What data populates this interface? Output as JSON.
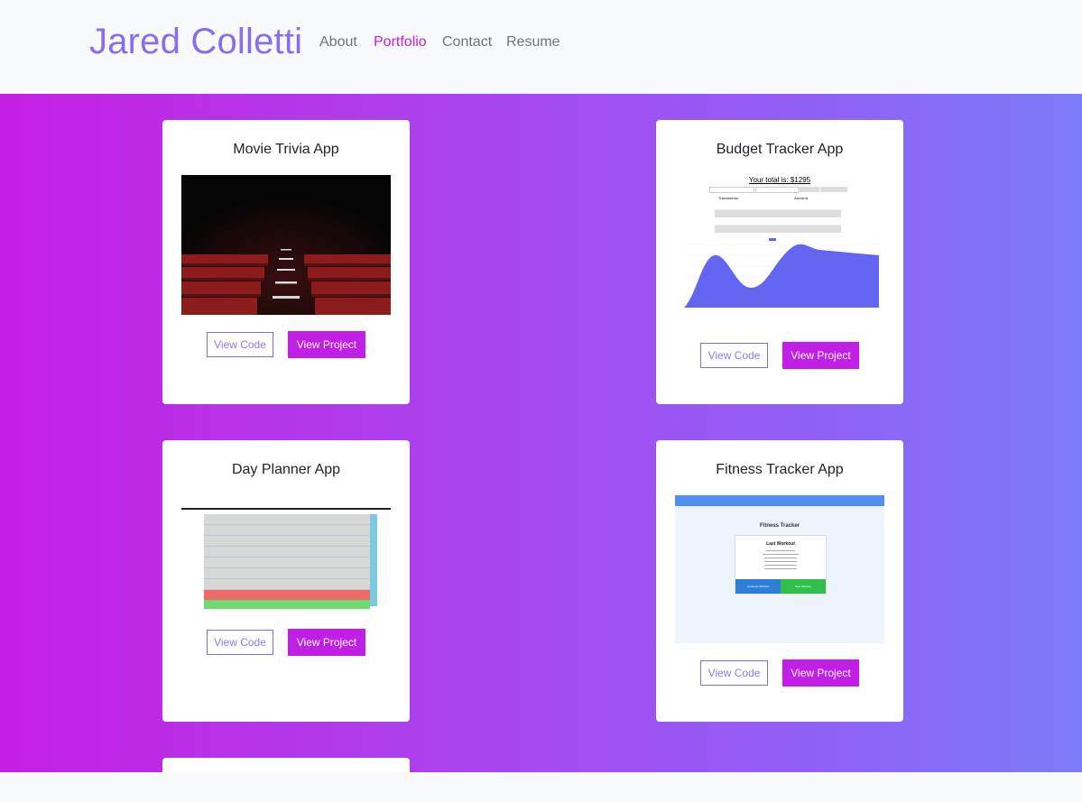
{
  "navbar": {
    "brand": "Jared Colletti",
    "links": [
      {
        "label": "About",
        "active": false
      },
      {
        "label": "Portfolio",
        "active": true
      },
      {
        "label": "Contact",
        "active": false
      },
      {
        "label": "Resume",
        "active": false
      }
    ]
  },
  "projects": [
    {
      "title": "Movie Trivia App",
      "code_label": "View Code",
      "view_label": "View Project",
      "thumbnail": "theater-seats-image"
    },
    {
      "title": "Budget Tracker App",
      "code_label": "View Code",
      "view_label": "View Project",
      "thumbnail": "budget-tracker-screenshot",
      "screenshot_text": {
        "total": "Your total is: $1295",
        "col_transaction": "Transaction",
        "col_amount": "Amount"
      }
    },
    {
      "title": "Day Planner App",
      "code_label": "View Code",
      "view_label": "View Project",
      "thumbnail": "day-planner-screenshot"
    },
    {
      "title": "Fitness Tracker App",
      "code_label": "View Code",
      "view_label": "View Project",
      "thumbnail": "fitness-tracker-screenshot",
      "screenshot_text": {
        "heading": "Fitness Tracker",
        "panel_title": "Last Workout",
        "continue": "Continue Workout",
        "new": "New Workout"
      }
    }
  ],
  "colors": {
    "accent": "#c11ee6",
    "brand": "#8a6cf0",
    "gradient_start": "#c51fe3",
    "gradient_end": "#7b7bf8"
  }
}
